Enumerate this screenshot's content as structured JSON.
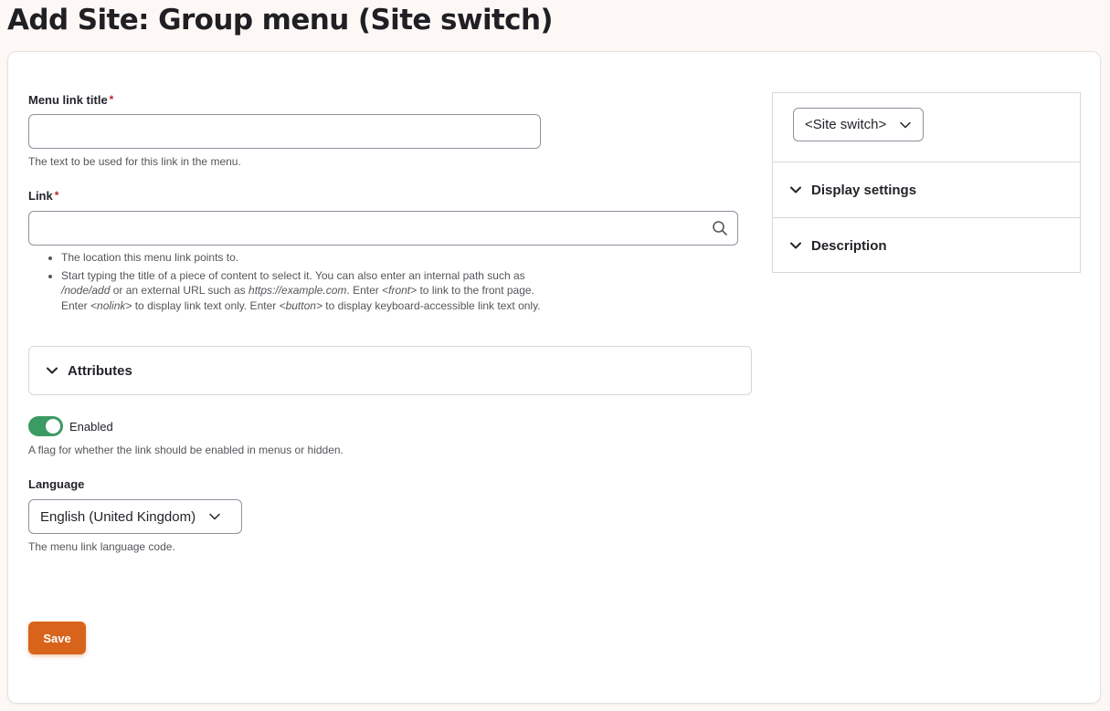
{
  "page": {
    "title": "Add Site: Group menu (Site switch)"
  },
  "form": {
    "menu_link_title": {
      "label": "Menu link title",
      "required_mark": "*",
      "value": "",
      "description": "The text to be used for this link in the menu."
    },
    "link": {
      "label": "Link",
      "required_mark": "*",
      "value": "",
      "description_items": [
        "The location this menu link points to.",
        "Start typing the title of a piece of content to select it. You can also enter an internal path such as /node/add or an external URL such as https://example.com. Enter <front> to link to the front page. Enter <nolink> to display link text only. Enter <button> to display keyboard-accessible link text only."
      ],
      "desc2": {
        "t1": "Start typing the title of a piece of content to select it. You can also enter an internal path such as ",
        "e1": "/node/add",
        "t2": " or an external URL such as ",
        "e2": "https://example.com",
        "t3": ". Enter ",
        "e3": "<front>",
        "t4": " to link to the front page. Enter ",
        "e4": "<nolink>",
        "t5": " to display link text only. Enter ",
        "e5": "<button>",
        "t6": " to display keyboard-accessible link text only."
      }
    },
    "attributes": {
      "label": "Attributes"
    },
    "enabled": {
      "label": "Enabled",
      "checked": true,
      "description": "A flag for whether the link should be enabled in menus or hidden."
    },
    "language": {
      "label": "Language",
      "selected": "English (United Kingdom)",
      "description": "The menu link language code."
    },
    "save_label": "Save"
  },
  "sidebar": {
    "parent_select": "<Site switch>",
    "sections": [
      {
        "label": "Display settings"
      },
      {
        "label": "Description"
      }
    ]
  },
  "colors": {
    "accent": "#d8631a",
    "toggle_on": "#3c9a64",
    "required": "#c0212c",
    "background": "#fdf8f5"
  },
  "icons": {
    "search": "search-icon",
    "chevron": "chevron-down-icon"
  }
}
